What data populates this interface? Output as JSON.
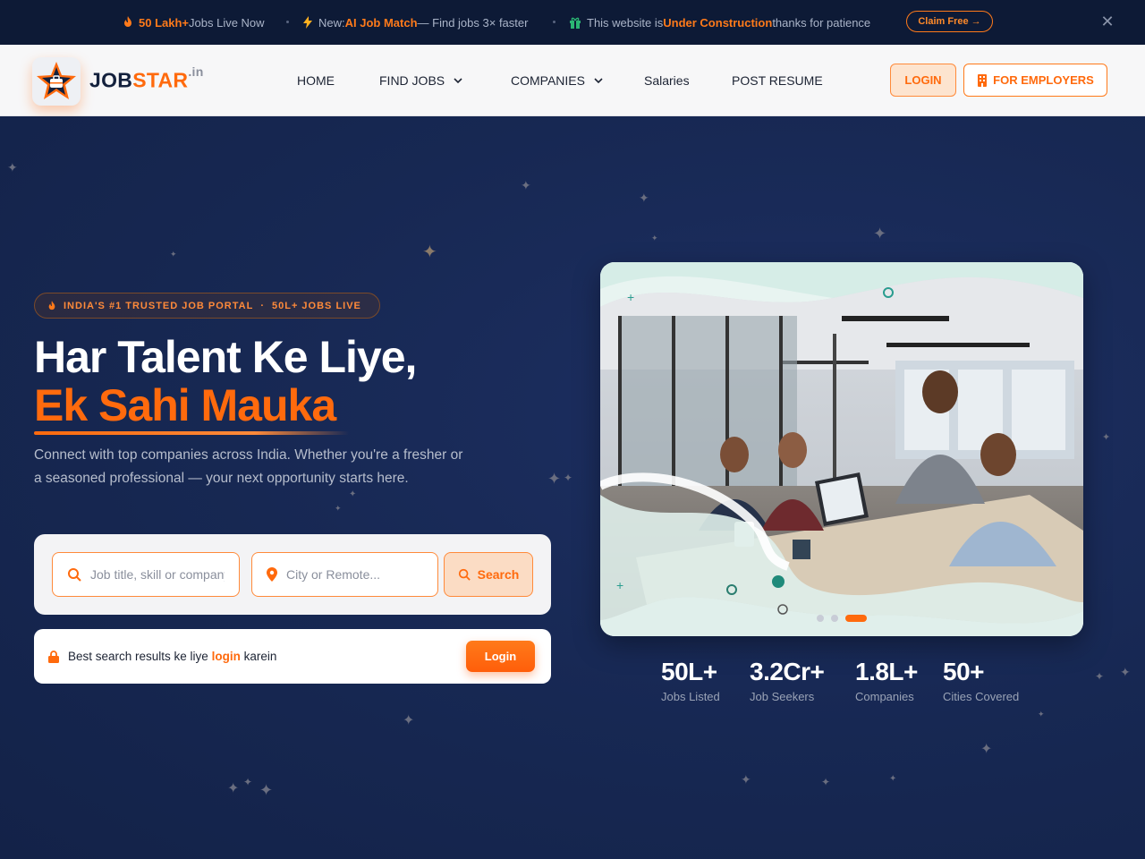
{
  "announcement": {
    "item1": {
      "highlight": "50 Lakh+",
      "text": " Jobs Live Now"
    },
    "item2": {
      "prefix": "New: ",
      "highlight": "AI Job Match",
      "suffix": " — Find jobs 3× faster"
    },
    "item3": {
      "prefix": "This website is ",
      "highlight": "Under Construction",
      "suffix": " thanks for patience"
    },
    "claim_label": "Claim Free →",
    "close_label": "✕"
  },
  "header": {
    "logo_main": "JOB",
    "logo_accent": "STAR",
    "logo_suffix": ".in",
    "nav": [
      "HOME",
      "FIND JOBS",
      "COMPANIES",
      "Salaries",
      "POST RESUME"
    ],
    "login_label": "LOGIN",
    "employers_label": "FOR EMPLOYERS"
  },
  "hero": {
    "tagline_a": "INDIA'S #1 TRUSTED JOB PORTAL",
    "tagline_sep": "·",
    "tagline_b": "50L+ JOBS LIVE",
    "heading_line1": "Har Talent Ke Liye,",
    "heading_line2": "Ek Sahi Mauka",
    "description": "Connect with top companies across India. Whether you're a fresher or a seasoned professional — your next opportunity starts here.",
    "search": {
      "keyword_placeholder": "Job title, skill or company",
      "location_placeholder": "City or Remote...",
      "button_label": "Search"
    },
    "login_prompt": {
      "prefix": "Best search results ke liye ",
      "link": "login",
      "suffix": " karein",
      "button_label": "Login"
    },
    "stats": [
      {
        "value": "50L+",
        "label": "Jobs Listed"
      },
      {
        "value": "3.2Cr+",
        "label": "Job Seekers"
      },
      {
        "value": "1.8L+",
        "label": "Companies"
      },
      {
        "value": "50+",
        "label": "Cities Covered"
      }
    ]
  },
  "colors": {
    "accent": "#ff6a0d",
    "navy": "#15244d"
  }
}
